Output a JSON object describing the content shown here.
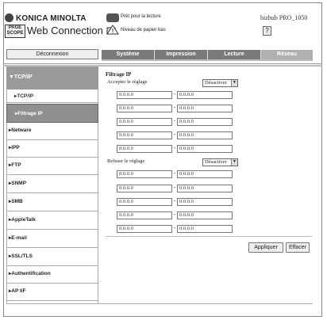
{
  "header": {
    "brand": "KONICA MINOLTA",
    "pagescope_badge": "PAGE SCOPE",
    "product": "Web Connection",
    "status": [
      {
        "label": "Prêt pour la lecture",
        "icon": "printer-ready-icon"
      },
      {
        "label": "Niveau de papier bas",
        "icon": "paper-warning-icon"
      }
    ],
    "model": "bizhub PRO_1050",
    "help_icon": "?"
  },
  "logout_label": "Déconnexion",
  "tabs": [
    "Système",
    "Impression",
    "Lecture",
    "Réseau"
  ],
  "sidebar": {
    "top": "▼TCP/IP",
    "sub": [
      "▸TCP/IP",
      "▸Filtrage IP"
    ],
    "items": [
      "▸Netware",
      "▸IPP",
      "▸FTP",
      "▸SNMP",
      "▸SMB",
      "▸AppleTalk",
      "▸E-mail",
      "▸SSL/TLS",
      "▸Authentification",
      "▸AP I/F"
    ]
  },
  "main": {
    "title": "Filtrage IP",
    "accept": {
      "label": "Accepter le réglage",
      "select": "Désactiver",
      "rows": [
        [
          "0.0.0.0",
          "0.0.0.0"
        ],
        [
          "0.0.0.0",
          "0.0.0.0"
        ],
        [
          "0.0.0.0",
          "0.0.0.0"
        ],
        [
          "0.0.0.0",
          "0.0.0.0"
        ],
        [
          "0.0.0.0",
          "0.0.0.0"
        ]
      ]
    },
    "refuse": {
      "label": "Refuser le réglage",
      "select": "Désactiver",
      "rows": [
        [
          "0.0.0.0",
          "0.0.0.0"
        ],
        [
          "0.0.0.0",
          "0.0.0.0"
        ],
        [
          "0.0.0.0",
          "0.0.0.0"
        ],
        [
          "0.0.0.0",
          "0.0.0.0"
        ],
        [
          "0.0.0.0",
          "0.0.0.0"
        ]
      ]
    },
    "dash": "-",
    "apply_label": "Appliquer",
    "clear_label": "Effacer"
  }
}
